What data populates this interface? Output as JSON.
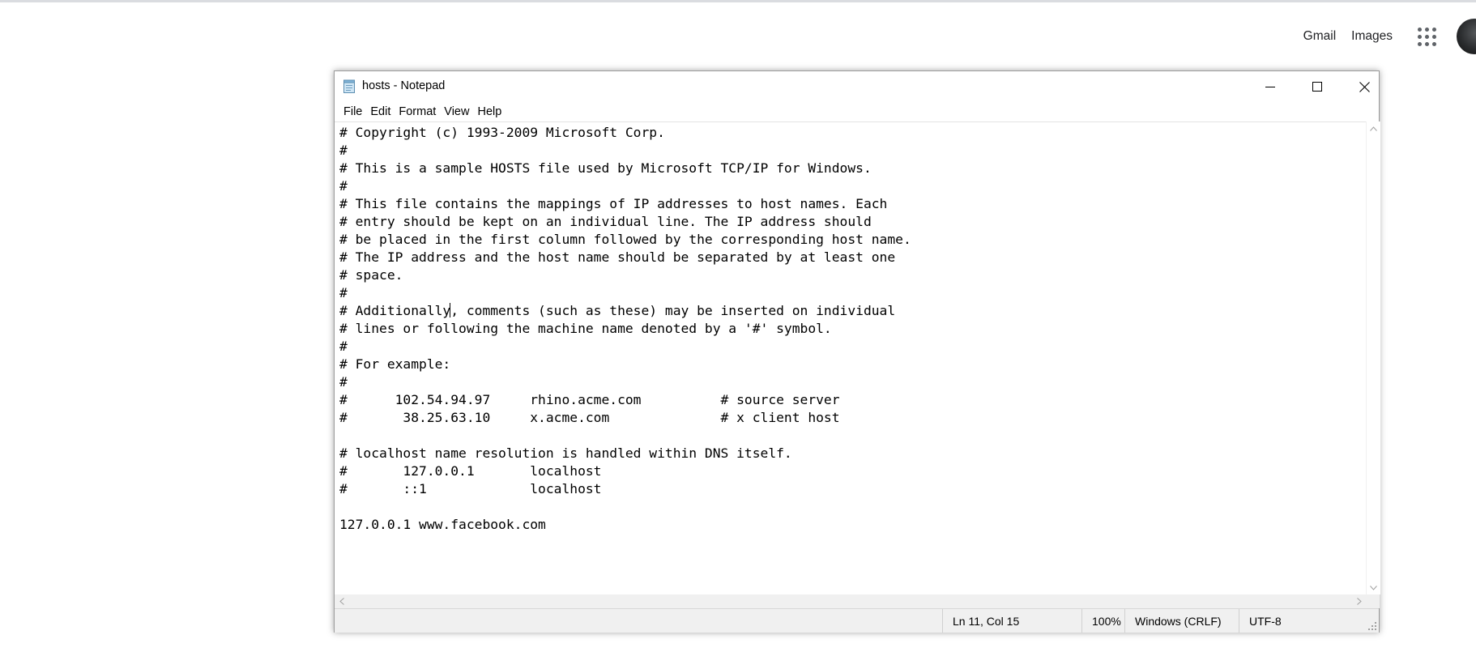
{
  "google_bar": {
    "gmail_label": "Gmail",
    "images_label": "Images"
  },
  "notepad": {
    "title": "hosts - Notepad",
    "menu": [
      "File",
      "Edit",
      "Format",
      "View",
      "Help"
    ],
    "lines_before_caret": "# Copyright (c) 1993-2009 Microsoft Corp.\n#\n# This is a sample HOSTS file used by Microsoft TCP/IP for Windows.\n#\n# This file contains the mappings of IP addresses to host names. Each\n# entry should be kept on an individual line. The IP address should\n# be placed in the first column followed by the corresponding host name.\n# The IP address and the host name should be separated by at least one\n# space.\n#\n# Additionally",
    "lines_after_caret": ", comments (such as these) may be inserted on individual\n# lines or following the machine name denoted by a '#' symbol.\n#\n# For example:\n#\n#      102.54.94.97     rhino.acme.com          # source server\n#       38.25.63.10     x.acme.com              # x client host\n\n# localhost name resolution is handled within DNS itself.\n#\t127.0.0.1       localhost\n#\t::1             localhost\n\n127.0.0.1 www.facebook.com",
    "status": {
      "position": "Ln 11, Col 15",
      "zoom": "100%",
      "line_ending": "Windows (CRLF)",
      "encoding": "UTF-8"
    }
  },
  "icons": {
    "minimize": "minimize-icon",
    "maximize": "maximize-icon",
    "close": "close-icon",
    "apps": "apps-grid-icon",
    "avatar": "account-avatar"
  }
}
